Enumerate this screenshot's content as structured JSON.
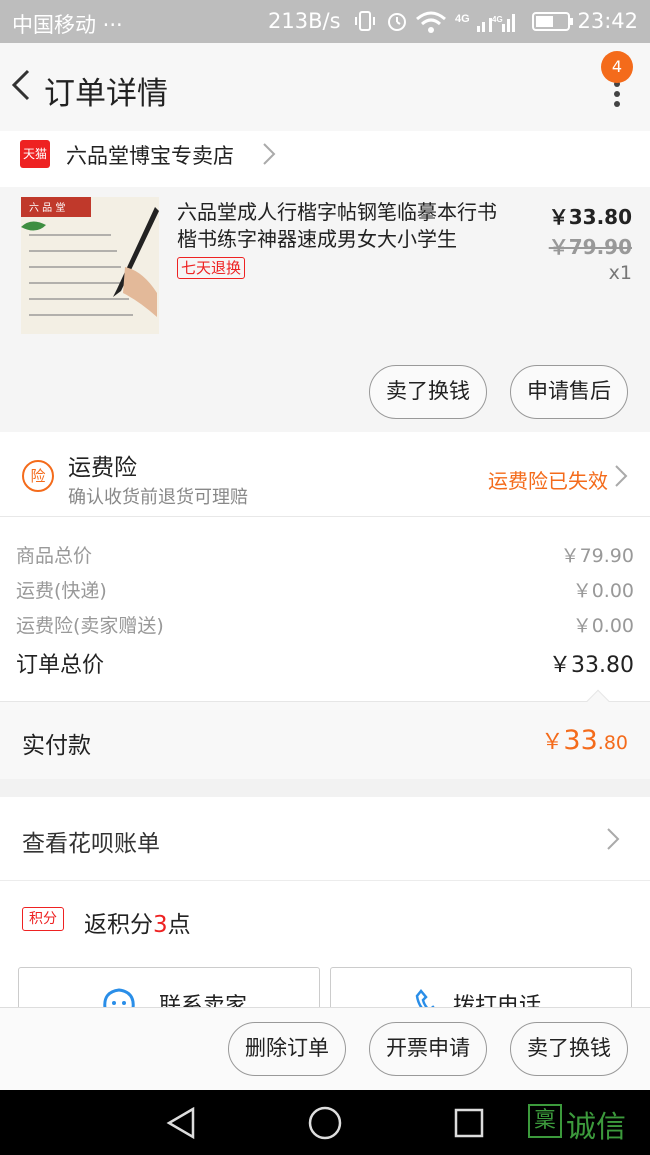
{
  "statusbar": {
    "carrier": "中国移动 ···",
    "speed": "213B/s",
    "time": "23:42"
  },
  "header": {
    "title": "订单详情",
    "badge": "4"
  },
  "shop": {
    "name": "六品堂博宝专卖店",
    "tmall_label": "天猫"
  },
  "product": {
    "name": "六品堂成人行楷字帖钢笔临摹本行书楷书练字神器速成男女大小学生",
    "tag": "七天退换",
    "price": "￥33.80",
    "original_price": "￥79.90",
    "quantity": "x1",
    "actions": [
      "卖了换钱",
      "申请售后"
    ]
  },
  "insurance": {
    "icon_label": "险",
    "title": "运费险",
    "subtitle": "确认收货前退货可理赔",
    "status": "运费险已失效"
  },
  "summary": {
    "rows": [
      {
        "label": "商品总价",
        "value": "￥79.90"
      },
      {
        "label": "运费(快递)",
        "value": "￥0.00"
      },
      {
        "label": "运费险(卖家赠送)",
        "value": "￥0.00"
      }
    ],
    "total_label": "订单总价",
    "total_value": "￥33.80"
  },
  "paid": {
    "label": "实付款",
    "currency": "￥",
    "integer": "33",
    "decimal": ".80"
  },
  "huabei": {
    "label": "查看花呗账单"
  },
  "points": {
    "tag": "积分",
    "prefix": "返积分",
    "num": "3",
    "suffix": "点"
  },
  "contact": {
    "seller_label": "联系卖家",
    "call_label": "拨打电话"
  },
  "bottom_actions": [
    "删除订单",
    "开票申请",
    "卖了换钱"
  ],
  "watermark": {
    "text": "诚信",
    "url": "JiChengXin.com"
  },
  "colors": {
    "accent": "#f46b1b",
    "tmall_red": "#e22222"
  }
}
